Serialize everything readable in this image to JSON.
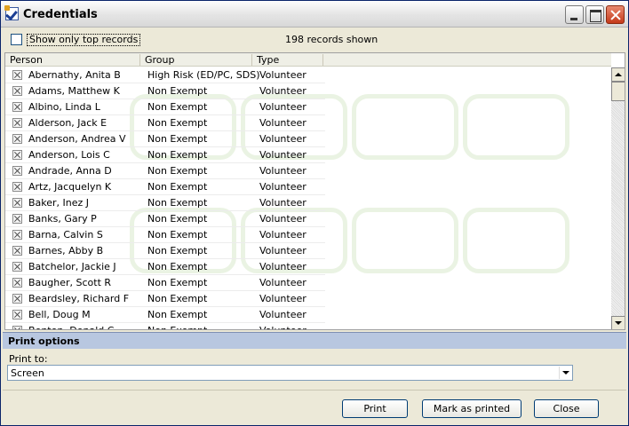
{
  "window": {
    "title": "Credentials"
  },
  "filter": {
    "show_top_label": "Show only top records",
    "show_top_checked": false,
    "records_shown": "198 records shown"
  },
  "columns": {
    "person": "Person",
    "group": "Group",
    "type": "Type"
  },
  "rows": [
    {
      "person": "Abernathy, Anita B",
      "group": "High Risk (ED/PC, SDS)",
      "type": "Volunteer"
    },
    {
      "person": "Adams, Matthew K",
      "group": "Non Exempt",
      "type": "Volunteer"
    },
    {
      "person": "Albino, Linda L",
      "group": "Non Exempt",
      "type": "Volunteer"
    },
    {
      "person": "Alderson, Jack E",
      "group": "Non Exempt",
      "type": "Volunteer"
    },
    {
      "person": "Anderson, Andrea V",
      "group": "Non Exempt",
      "type": "Volunteer"
    },
    {
      "person": "Anderson, Lois C",
      "group": "Non Exempt",
      "type": "Volunteer"
    },
    {
      "person": "Andrade, Anna D",
      "group": "Non Exempt",
      "type": "Volunteer"
    },
    {
      "person": "Artz, Jacquelyn K",
      "group": "Non Exempt",
      "type": "Volunteer"
    },
    {
      "person": "Baker, Inez J",
      "group": "Non Exempt",
      "type": "Volunteer"
    },
    {
      "person": "Banks, Gary P",
      "group": "Non Exempt",
      "type": "Volunteer"
    },
    {
      "person": "Barna, Calvin S",
      "group": "Non Exempt",
      "type": "Volunteer"
    },
    {
      "person": "Barnes, Abby B",
      "group": "Non Exempt",
      "type": "Volunteer"
    },
    {
      "person": "Batchelor, Jackie J",
      "group": "Non Exempt",
      "type": "Volunteer"
    },
    {
      "person": "Baugher, Scott R",
      "group": "Non Exempt",
      "type": "Volunteer"
    },
    {
      "person": "Beardsley, Richard F",
      "group": "Non Exempt",
      "type": "Volunteer"
    },
    {
      "person": "Bell, Doug M",
      "group": "Non Exempt",
      "type": "Volunteer"
    },
    {
      "person": "Benton, Donald C",
      "group": "Non Exempt",
      "type": "Volunteer"
    }
  ],
  "print_options": {
    "header": "Print options",
    "print_to_label": "Print to:",
    "print_to_value": "Screen"
  },
  "buttons": {
    "print": "Print",
    "mark_printed": "Mark as printed",
    "close": "Close"
  },
  "colors": {
    "section_header": "#b8c7e0",
    "window_bg": "#ece9d8"
  }
}
